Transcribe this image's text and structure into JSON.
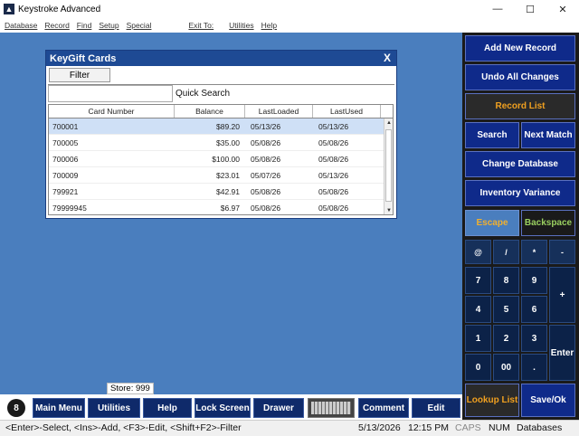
{
  "window": {
    "title": "Keystroke Advanced",
    "minimize": "—",
    "maximize": "☐",
    "close": "✕"
  },
  "menu": [
    "Database",
    "Record",
    "Find",
    "Setup",
    "Special",
    "Exit To:",
    "Utilities",
    "Help"
  ],
  "dialog": {
    "title": "KeyGift Cards",
    "close": "X",
    "filter_label": "Filter",
    "quick_search_label": "Quick Search",
    "quick_search_value": "",
    "columns": [
      "Card Number",
      "Balance",
      "LastLoaded",
      "LastUsed"
    ],
    "rows": [
      [
        "700001",
        "$89.20",
        "05/13/26",
        "05/13/26"
      ],
      [
        "700005",
        "$35.00",
        "05/08/26",
        "05/08/26"
      ],
      [
        "700006",
        "$100.00",
        "05/08/26",
        "05/08/26"
      ],
      [
        "700009",
        "$23.01",
        "05/07/26",
        "05/13/26"
      ],
      [
        "799921",
        "$42.91",
        "05/08/26",
        "05/08/26"
      ],
      [
        "79999945",
        "$6.97",
        "05/08/26",
        "05/08/26"
      ]
    ]
  },
  "right_panel": {
    "add_new_record": "Add New Record",
    "undo_all_changes": "Undo All Changes",
    "record_list": "Record List",
    "search": "Search",
    "next_match": "Next Match",
    "change_database": "Change Database",
    "inventory_variance": "Inventory Variance",
    "escape": "Escape",
    "backspace": "Backspace",
    "keys_row1": [
      "@",
      "/",
      "*",
      "-"
    ],
    "keys_row2": [
      "7",
      "8",
      "9"
    ],
    "keys_row3": [
      "4",
      "5",
      "6"
    ],
    "keys_row4": [
      "1",
      "2",
      "3"
    ],
    "keys_row5": [
      "0",
      "00",
      "."
    ],
    "plus": "+",
    "enter": "Enter",
    "lookup_list": "Lookup List",
    "save_ok": "Save/Ok"
  },
  "toolbar": {
    "logo": "8",
    "main_menu": "Main Menu",
    "utilities": "Utilities",
    "help": "Help",
    "lock_screen": "Lock Screen",
    "drawer": "Drawer",
    "comment": "Comment",
    "edit": "Edit",
    "store_tip": "Store: 999"
  },
  "status": {
    "hint": "<Enter>-Select, <Ins>-Add, <F3>-Edit, <Shift+F2>-Filter",
    "date": "5/13/2026",
    "time": "12:15 PM",
    "caps": "CAPS",
    "num": "NUM",
    "context": "Databases"
  },
  "colors": {
    "workspace": "#4a7ebe",
    "button_blue": "#0f2a8a",
    "accent_orange": "#f0a020",
    "accent_green": "#9ad060"
  }
}
